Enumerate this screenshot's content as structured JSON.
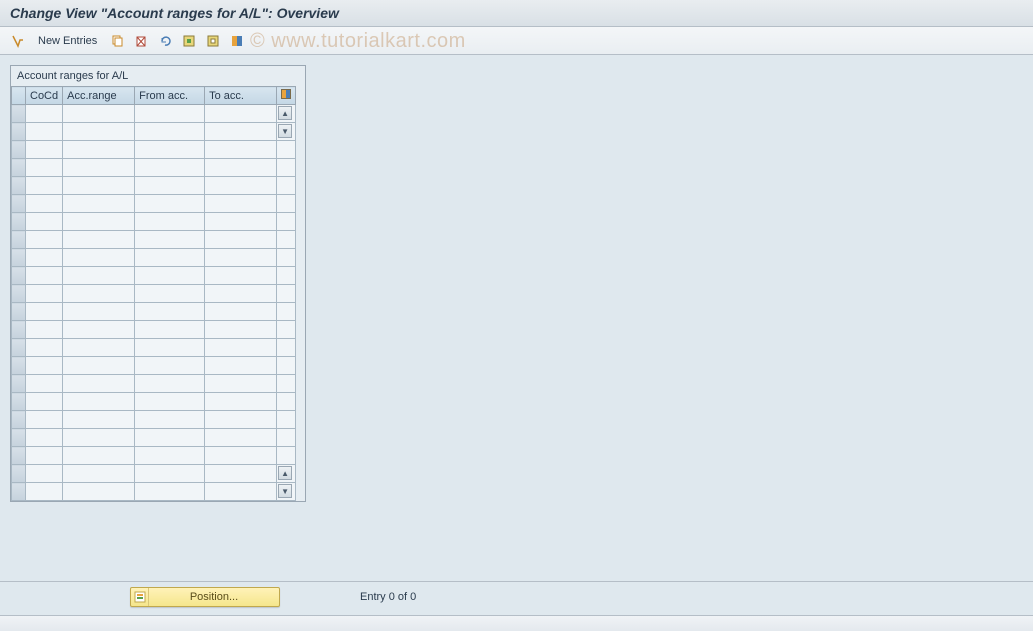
{
  "title": "Change View \"Account ranges for A/L\": Overview",
  "watermark": "© www.tutorialkart.com",
  "toolbar": {
    "new_entries": "New Entries"
  },
  "table": {
    "title": "Account ranges for A/L",
    "columns": {
      "cocd": "CoCd",
      "accrange": "Acc.range",
      "fromacc": "From acc.",
      "toacc": "To acc."
    },
    "row_count": 22
  },
  "footer": {
    "position_label": "Position...",
    "entry_label": "Entry 0 of 0"
  }
}
